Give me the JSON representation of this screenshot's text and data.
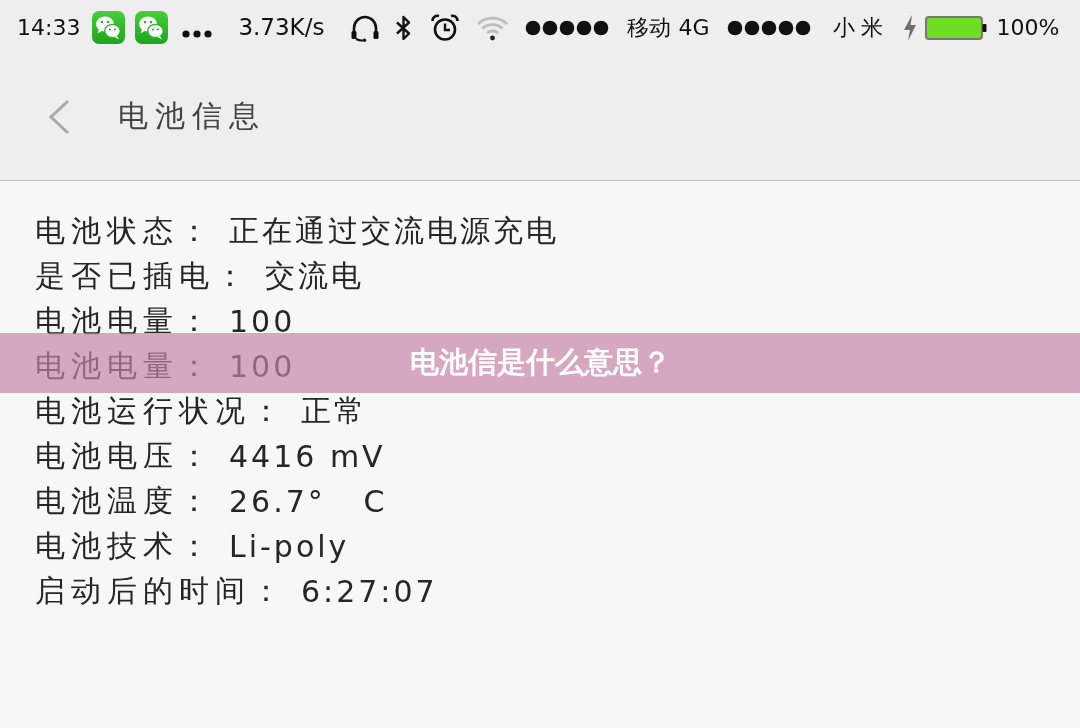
{
  "status_bar": {
    "time": "14:33",
    "net_speed": "3.73K/s",
    "carrier_1": "移动 4G",
    "carrier_2": "小米",
    "charging": true,
    "battery": "100%"
  },
  "header": {
    "title": "电池信息"
  },
  "battery_info": [
    {
      "label": "电池状态：",
      "value": "正在通过交流电源充电"
    },
    {
      "label": "是否已插电：",
      "value": "交流电"
    },
    {
      "label": "电池电量：",
      "value": "100"
    },
    {
      "label": "电池电量：",
      "value": "100"
    },
    {
      "label": "电池运行状况：",
      "value": "正常"
    },
    {
      "label": "电池电压：",
      "value": "4416 mV"
    },
    {
      "label": "电池温度：",
      "value": "26.7°   C"
    },
    {
      "label": "电池技术：",
      "value": "Li-poly"
    },
    {
      "label": "启动后的时间：",
      "value": "6:27:07"
    }
  ],
  "banner": {
    "text": "电池信是什么意思？"
  }
}
